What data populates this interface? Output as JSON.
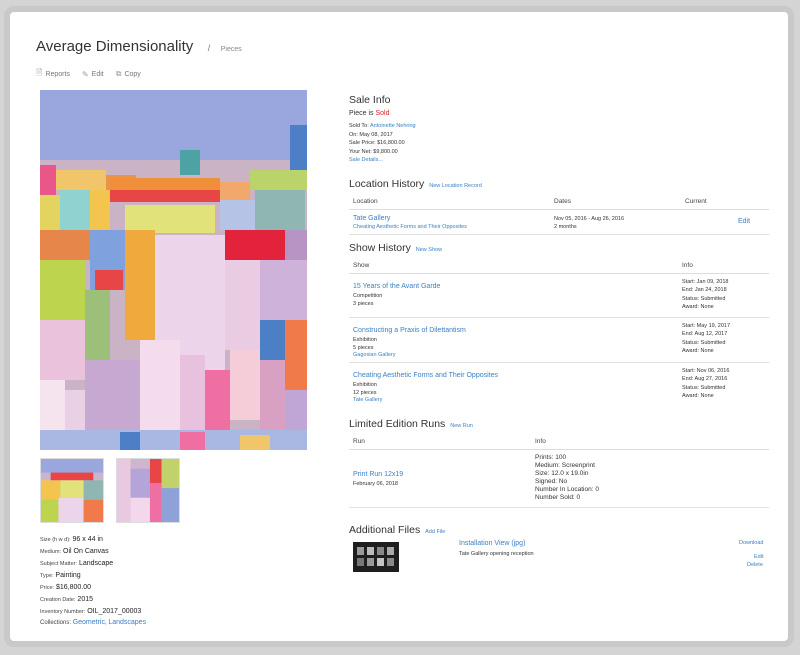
{
  "header": {
    "title": "Average Dimensionality",
    "separator": "/",
    "breadcrumb": "Pieces"
  },
  "toolbar": {
    "reports": "Reports",
    "edit": "Edit",
    "copy": "Copy"
  },
  "details": {
    "size_label": "Size (h w d):",
    "size_value": "96 x 44 in",
    "medium_label": "Medium:",
    "medium_value": "Oil On Canvas",
    "subject_label": "Subject Matter:",
    "subject_value": "Landscape",
    "type_label": "Type:",
    "type_value": "Painting",
    "price_label": "Price:",
    "price_value": "$16,800.00",
    "creation_label": "Creation Date:",
    "creation_value": "2015",
    "inventory_label": "Inventory Number:",
    "inventory_value": "OIL_2017_00003"
  },
  "collections": {
    "label": "Collections:",
    "item1": "Geometric",
    "sep": ",",
    "item2": "Landscapes"
  },
  "sale": {
    "title": "Sale Info",
    "status_prefix": "Piece is",
    "status": "Sold",
    "sold_to_label": "Sold To:",
    "sold_to": "Antoinette Nehring",
    "on": "On: May 08, 2017",
    "sale_price": "Sale Price: $16,800.00",
    "your_net": "Your Net: $9,800.00",
    "details_link": "Sale Details..."
  },
  "location_history": {
    "title": "Location History",
    "action": "New Location Record",
    "headers": [
      "Location",
      "Dates",
      "Current"
    ],
    "row": {
      "location": "Tate Gallery",
      "show": "Cheating Aesthetic Forms and Their Opposites",
      "dates": "Nov 05, 2016 - Aug 26, 2016",
      "duration": "2 months",
      "edit": "Edit"
    }
  },
  "show_history": {
    "title": "Show History",
    "action": "New Show",
    "headers": [
      "Show",
      "Info"
    ],
    "rows": [
      {
        "name": "15 Years of the Avant Garde",
        "type": "Competition",
        "pieces": "3 pieces",
        "gallery": "",
        "start": "Start: Jan 09, 2018",
        "end": "End: Jan 24, 2018",
        "status": "Status: Submitted",
        "award": "Award: None"
      },
      {
        "name": "Constructing a Praxis of Dilettantism",
        "type": "Exhibition",
        "pieces": "5 pieces",
        "gallery": "Gagosian Gallery",
        "start": "Start: May 19, 2017",
        "end": "End: Aug 12, 2017",
        "status": "Status: Submitted",
        "award": "Award: None"
      },
      {
        "name": "Cheating Aesthetic Forms and Their Opposites",
        "type": "Exhibition",
        "pieces": "12 pieces",
        "gallery": "Tate Gallery",
        "start": "Start: Nov 06, 2016",
        "end": "End: Aug 27, 2016",
        "status": "Status: Submitted",
        "award": "Award: None"
      }
    ]
  },
  "editions": {
    "title": "Limited Edition Runs",
    "action": "New Run",
    "headers": [
      "Run",
      "Info"
    ],
    "row": {
      "name": "Print Run 12x19",
      "date": "February 06, 2018",
      "prints": "Prints: 100",
      "medium": "Medium: Screenprint",
      "size": "Size: 12.0 x 19.0in",
      "signed": "Signed: No",
      "in_location": "Number In Location: 0",
      "sold": "Number Sold: 0"
    }
  },
  "files": {
    "title": "Additional Files",
    "action": "Add File",
    "row": {
      "name": "Installation View (jpg)",
      "desc": "Tate Gallery opening reception",
      "download": "Download",
      "edit": "Edit",
      "delete": "Delete"
    }
  }
}
